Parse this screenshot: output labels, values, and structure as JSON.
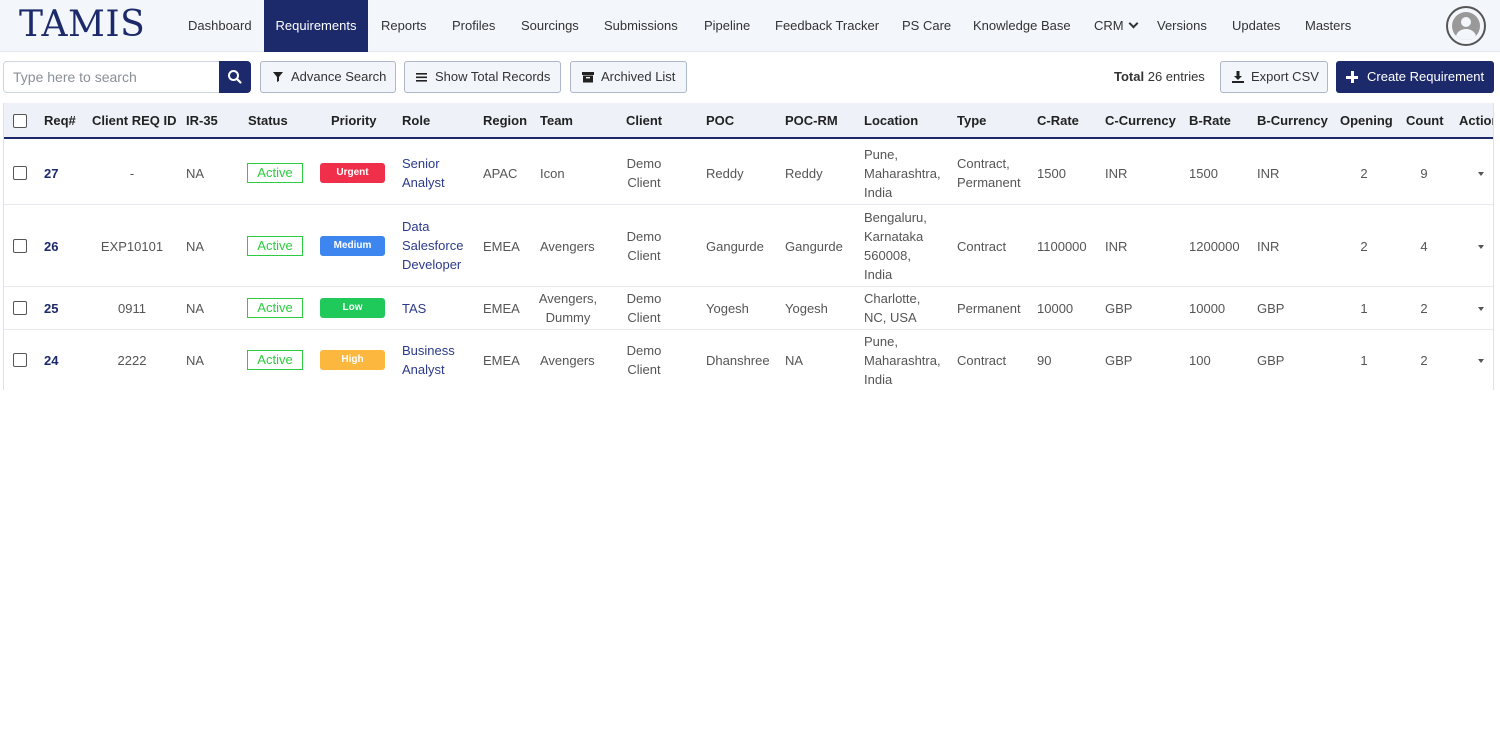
{
  "app": {
    "logo": "TAMIS"
  },
  "nav": {
    "items": [
      "Dashboard",
      "Requirements",
      "Reports",
      "Profiles",
      "Sourcings",
      "Submissions",
      "Pipeline",
      "Feedback Tracker",
      "PS Care",
      "Knowledge Base",
      "CRM",
      "Versions",
      "Updates",
      "Masters"
    ],
    "active": "Requirements"
  },
  "toolbar": {
    "search_placeholder": "Type here to search",
    "advance_search": "Advance Search",
    "show_total_records": "Show Total Records",
    "archived_list": "Archived List",
    "total_label": "Total",
    "total_value": "26 entries",
    "export_csv": "Export CSV",
    "create_requirement": "Create Requirement"
  },
  "table": {
    "columns": [
      "Req#",
      "Client REQ ID",
      "IR-35",
      "Status",
      "Priority",
      "Role",
      "Region",
      "Team",
      "Client",
      "POC",
      "POC-RM",
      "Location",
      "Type",
      "C-Rate",
      "C-Currency",
      "B-Rate",
      "B-Currency",
      "Opening",
      "Count",
      "Action"
    ],
    "rows": [
      {
        "req": "27",
        "client_req_id": "-",
        "ir35": "NA",
        "status": "Active",
        "priority": "Urgent",
        "priority_color": "#f0304a",
        "role": [
          "Senior",
          "Analyst"
        ],
        "region": "APAC",
        "team": [
          "Icon"
        ],
        "client": [
          "Demo",
          "Client"
        ],
        "poc": "Reddy",
        "poc_rm": "Reddy",
        "location": [
          "Pune,",
          "Maharashtra,",
          "India"
        ],
        "type": [
          "Contract,",
          "Permanent"
        ],
        "c_rate": "1500",
        "c_currency": "INR",
        "b_rate": "1500",
        "b_currency": "INR",
        "opening": "2",
        "count": "9"
      },
      {
        "req": "26",
        "client_req_id": "EXP10101",
        "ir35": "NA",
        "status": "Active",
        "priority": "Medium",
        "priority_color": "#3d86f0",
        "role": [
          "Data",
          "Salesforce",
          "Developer"
        ],
        "region": "EMEA",
        "team": [
          "Avengers"
        ],
        "client": [
          "Demo",
          "Client"
        ],
        "poc": "Gangurde",
        "poc_rm": "Gangurde",
        "location": [
          "Bengaluru,",
          "Karnataka",
          "560008,",
          "India"
        ],
        "type": [
          "Contract"
        ],
        "c_rate": "1100000",
        "c_currency": "INR",
        "b_rate": "1200000",
        "b_currency": "INR",
        "opening": "2",
        "count": "4"
      },
      {
        "req": "25",
        "client_req_id": "0911",
        "ir35": "NA",
        "status": "Active",
        "priority": "Low",
        "priority_color": "#1fc95a",
        "role": [
          "TAS"
        ],
        "region": "EMEA",
        "team": [
          "Avengers,",
          "Dummy"
        ],
        "client": [
          "Demo",
          "Client"
        ],
        "poc": "Yogesh",
        "poc_rm": "Yogesh",
        "location": [
          "Charlotte,",
          "NC, USA"
        ],
        "type": [
          "Permanent"
        ],
        "c_rate": "10000",
        "c_currency": "GBP",
        "b_rate": "10000",
        "b_currency": "GBP",
        "opening": "1",
        "count": "2"
      },
      {
        "req": "24",
        "client_req_id": "2222",
        "ir35": "NA",
        "status": "Active",
        "priority": "High",
        "priority_color": "#fcb73e",
        "role": [
          "Business",
          "Analyst"
        ],
        "region": "EMEA",
        "team": [
          "Avengers"
        ],
        "client": [
          "Demo",
          "Client"
        ],
        "poc": "Dhanshree",
        "poc_rm": "NA",
        "location": [
          "Pune,",
          "Maharashtra,",
          "India"
        ],
        "type": [
          "Contract"
        ],
        "c_rate": "90",
        "c_currency": "GBP",
        "b_rate": "100",
        "b_currency": "GBP",
        "opening": "1",
        "count": "2"
      }
    ]
  },
  "colors": {
    "primary": "#1c2a6b",
    "status_active": "#2ecc40"
  }
}
